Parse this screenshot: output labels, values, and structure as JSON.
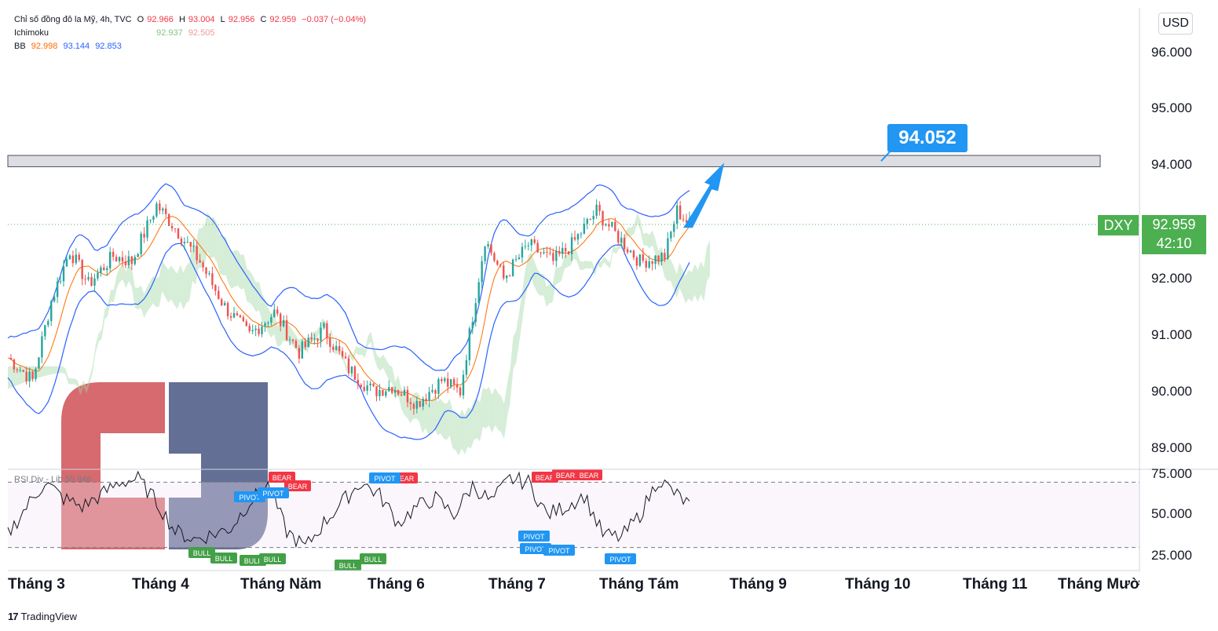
{
  "legend": {
    "symbol_line": "Chỉ số đồng đô la Mỹ, 4h, TVC",
    "o_label": "O",
    "o_value": "92.966",
    "h_label": "H",
    "h_value": "93.004",
    "l_label": "L",
    "l_value": "92.956",
    "c_label": "C",
    "c_value": "92.959",
    "change": "−0.037 (−0.04%)",
    "ichimoku_label": "Ichimoku",
    "ichimoku_v1": "92.937",
    "ichimoku_v2": "92.505",
    "bb_label": "BB",
    "bb_v1": "92.998",
    "bb_v2": "93.144",
    "bb_v3": "92.853"
  },
  "rsi_legend": {
    "label": "RSI Div - Lib",
    "value": "55.946"
  },
  "currency": "USD",
  "price_axis": [
    "96.000",
    "95.000",
    "94.000",
    "92.000",
    "91.000",
    "90.000",
    "89.000"
  ],
  "rsi_axis": [
    "75.000",
    "50.000",
    "25.000"
  ],
  "time_axis": [
    "Tháng 3",
    "Tháng 4",
    "Tháng Năm",
    "Tháng 6",
    "Tháng 7",
    "Tháng Tám",
    "Tháng 9",
    "Tháng 10",
    "Tháng 11",
    "Tháng Mười"
  ],
  "symbol_tag": "DXY",
  "last_price": "92.959",
  "countdown": "42:10",
  "target": "94.052",
  "signal_labels": {
    "bear": "BEAR",
    "bull": "BULL",
    "pivot": "PIVOT"
  },
  "brand": {
    "mark": "17",
    "name": "TradingView"
  },
  "colors": {
    "up": "#26a69a",
    "down": "#ef5350",
    "bb": "#2962ff",
    "ma": "#ff6d00",
    "cloud_bull": "#a5d6a7",
    "cloud_bear": "#f5b5b5",
    "last_price": "#4caf50",
    "target": "#2196f3",
    "logo_red": "#d25a5e",
    "logo_navy": "#535f8a"
  },
  "chart_data": {
    "type": "candlestick",
    "price_range": [
      88.5,
      96.5
    ],
    "resistance_zone": [
      93.98,
      94.18
    ],
    "target_level": 94.052,
    "last_price": 92.959,
    "price_path": [
      [
        0,
        90.6
      ],
      [
        4,
        90.2
      ],
      [
        7,
        91.6
      ],
      [
        10,
        92.5
      ],
      [
        13,
        91.9
      ],
      [
        17,
        92.4
      ],
      [
        20,
        92.3
      ],
      [
        24,
        93.3
      ],
      [
        27,
        92.9
      ],
      [
        31,
        92.3
      ],
      [
        35,
        91.5
      ],
      [
        39,
        91.0
      ],
      [
        43,
        91.4
      ],
      [
        47,
        90.7
      ],
      [
        51,
        91.1
      ],
      [
        55,
        90.4
      ],
      [
        59,
        90.0
      ],
      [
        62,
        90.1
      ],
      [
        66,
        89.8
      ],
      [
        70,
        90.2
      ],
      [
        73,
        90.0
      ],
      [
        77,
        92.7
      ],
      [
        80,
        92.0
      ],
      [
        84,
        92.6
      ],
      [
        88,
        92.3
      ],
      [
        91,
        92.6
      ],
      [
        95,
        93.2
      ],
      [
        98,
        92.8
      ],
      [
        102,
        92.3
      ],
      [
        106,
        92.4
      ],
      [
        108,
        93.2
      ],
      [
        110,
        92.96
      ]
    ],
    "rsi_range": [
      22,
      78
    ],
    "rsi_levels": [
      70,
      30
    ],
    "rsi_path": [
      [
        0,
        38
      ],
      [
        3,
        55
      ],
      [
        6,
        70
      ],
      [
        9,
        60
      ],
      [
        12,
        55
      ],
      [
        15,
        62
      ],
      [
        18,
        70
      ],
      [
        21,
        72
      ],
      [
        24,
        58
      ],
      [
        27,
        40
      ],
      [
        30,
        35
      ],
      [
        33,
        38
      ],
      [
        36,
        42
      ],
      [
        39,
        58
      ],
      [
        42,
        68
      ],
      [
        45,
        40
      ],
      [
        48,
        30
      ],
      [
        51,
        45
      ],
      [
        54,
        58
      ],
      [
        57,
        70
      ],
      [
        60,
        62
      ],
      [
        63,
        45
      ],
      [
        66,
        55
      ],
      [
        69,
        60
      ],
      [
        72,
        50
      ],
      [
        75,
        68
      ],
      [
        78,
        58
      ],
      [
        81,
        72
      ],
      [
        84,
        70
      ],
      [
        87,
        50
      ],
      [
        90,
        55
      ],
      [
        93,
        62
      ],
      [
        96,
        38
      ],
      [
        99,
        36
      ],
      [
        102,
        50
      ],
      [
        105,
        72
      ],
      [
        108,
        62
      ],
      [
        110,
        56
      ]
    ]
  }
}
